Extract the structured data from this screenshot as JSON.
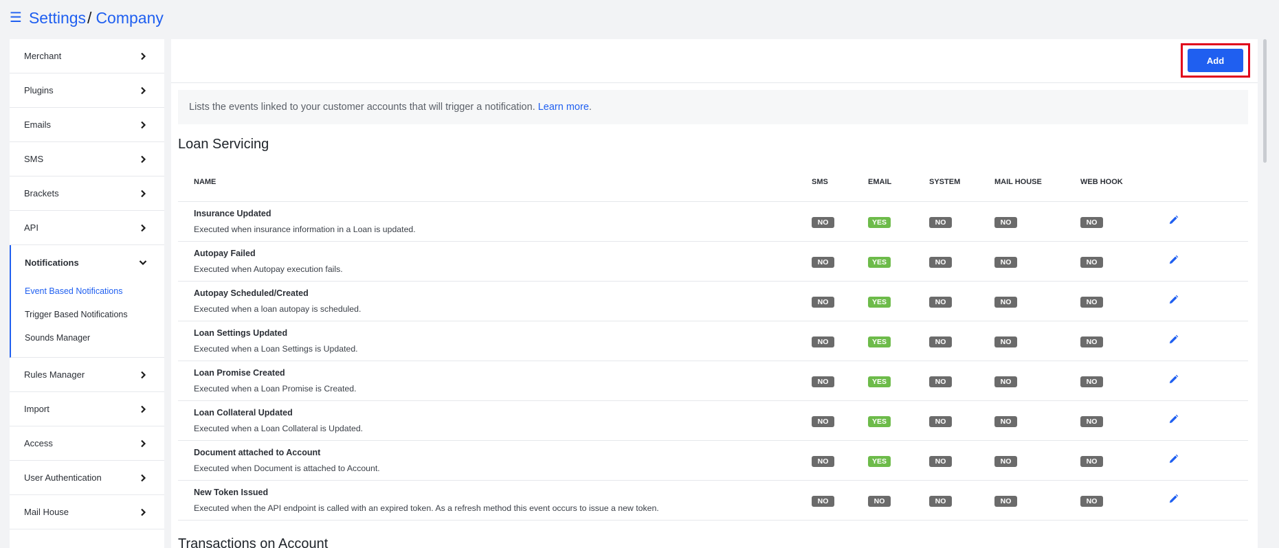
{
  "header": {
    "menu_icon": "hamburger-icon",
    "crumb_settings": "Settings",
    "crumb_sep": "/",
    "crumb_company": "Company"
  },
  "sidebar": {
    "items_top": [
      {
        "label": "Merchant"
      },
      {
        "label": "Plugins"
      },
      {
        "label": "Emails"
      },
      {
        "label": "SMS"
      },
      {
        "label": "Brackets"
      },
      {
        "label": "API"
      }
    ],
    "group": {
      "label": "Notifications",
      "sub": [
        {
          "label": "Event Based Notifications",
          "active": true
        },
        {
          "label": "Trigger Based Notifications"
        },
        {
          "label": "Sounds Manager"
        }
      ]
    },
    "items_bottom": [
      {
        "label": "Rules Manager"
      },
      {
        "label": "Import"
      },
      {
        "label": "Access"
      },
      {
        "label": "User Authentication"
      },
      {
        "label": "Mail House"
      }
    ]
  },
  "toolbar": {
    "add_label": "Add"
  },
  "info": {
    "text": "Lists the events linked to your customer accounts that will trigger a notification.",
    "link": "Learn more",
    "period": "."
  },
  "section1": {
    "title": "Loan Servicing"
  },
  "table": {
    "headers": {
      "name": "NAME",
      "sms": "SMS",
      "email": "EMAIL",
      "system": "SYSTEM",
      "mail_house": "MAIL HOUSE",
      "web_hook": "WEB HOOK"
    },
    "rows": [
      {
        "title": "Insurance Updated",
        "desc": "Executed when insurance information in a Loan is updated.",
        "sms": "NO",
        "email": "YES",
        "system": "NO",
        "mail_house": "NO",
        "web_hook": "NO"
      },
      {
        "title": "Autopay Failed",
        "desc": "Executed when Autopay execution fails.",
        "sms": "NO",
        "email": "YES",
        "system": "NO",
        "mail_house": "NO",
        "web_hook": "NO"
      },
      {
        "title": "Autopay Scheduled/Created",
        "desc": "Executed when a loan autopay is scheduled.",
        "sms": "NO",
        "email": "YES",
        "system": "NO",
        "mail_house": "NO",
        "web_hook": "NO"
      },
      {
        "title": "Loan Settings Updated",
        "desc": "Executed when a Loan Settings is Updated.",
        "sms": "NO",
        "email": "YES",
        "system": "NO",
        "mail_house": "NO",
        "web_hook": "NO"
      },
      {
        "title": "Loan Promise Created",
        "desc": "Executed when a Loan Promise is Created.",
        "sms": "NO",
        "email": "YES",
        "system": "NO",
        "mail_house": "NO",
        "web_hook": "NO"
      },
      {
        "title": "Loan Collateral Updated",
        "desc": "Executed when a Loan Collateral is Updated.",
        "sms": "NO",
        "email": "YES",
        "system": "NO",
        "mail_house": "NO",
        "web_hook": "NO"
      },
      {
        "title": "Document attached to Account",
        "desc": "Executed when Document is attached to Account.",
        "sms": "NO",
        "email": "YES",
        "system": "NO",
        "mail_house": "NO",
        "web_hook": "NO"
      },
      {
        "title": "New Token Issued",
        "desc": "Executed when the API endpoint is called with an expired token. As a refresh method this event occurs to issue a new token.",
        "sms": "NO",
        "email": "NO",
        "system": "NO",
        "mail_house": "NO",
        "web_hook": "NO"
      }
    ]
  },
  "section2": {
    "title": "Transactions on Account"
  },
  "colors": {
    "accent": "#1f5ff0",
    "yes": "#6dbb4a",
    "no": "#6b6b6b",
    "highlight": "#e0001b"
  }
}
